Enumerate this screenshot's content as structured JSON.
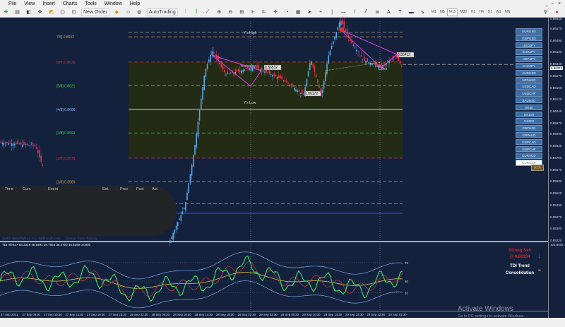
{
  "menu": [
    "File",
    "View",
    "Insert",
    "Charts",
    "Tools",
    "Window",
    "Help"
  ],
  "toolbar": {
    "new_order": "New Order",
    "autotrading": "AutoTrading",
    "timeframes": [
      "M1",
      "M5",
      "M15",
      "M30",
      "H1",
      "H4",
      "D1",
      "W1",
      "MN"
    ],
    "active_timeframe": "M15"
  },
  "price_axis": [
    "0.86570",
    "0.86495",
    "0.86420",
    "0.86345",
    "0.86270",
    "0.86195",
    "0.86120",
    "0.86045",
    "0.85970",
    "0.85900",
    "0.85825",
    "0.85750",
    "0.85675",
    "0.85600",
    "0.85525",
    "0.85450",
    "0.85375",
    "0.85300",
    "0.85225"
  ],
  "current_price": "0.86318",
  "top_price": "0.86645",
  "symbols": [
    "EURUSD",
    "GBPUSD",
    "USDJPY",
    "EURJPY",
    "GBPJPY",
    "CADJPY",
    "AUDUSD",
    "NZDUSD",
    "USDCAD",
    "USDCHF",
    "XAUUSD",
    "HK50",
    "UK100",
    "US500",
    "GBPNZD",
    "GBPAUD",
    "GBPCAD",
    "GBPCHF",
    "EURAUD",
    "EURGBP"
  ],
  "active_symbol": "EURGBP",
  "atr_label": "ATR",
  "murrey": [
    {
      "label": "7/8] 0.8652",
      "color": "#e0a040",
      "price": 0.8652
    },
    {
      "label": "[6/8] 0.8636",
      "color": "#e03040",
      "price": 0.8636
    },
    {
      "label": "[5/8] 0.8621",
      "color": "#40d040",
      "price": 0.8621
    },
    {
      "label": "[4/8] 0.8606",
      "color": "#8fb8ff",
      "price": 0.8606
    },
    {
      "label": "[3/8] 0.8591",
      "color": "#40d040",
      "price": 0.8591
    },
    {
      "label": "[2/8] 0.8575",
      "color": "#e03040",
      "price": 0.8575
    },
    {
      "label": "[1/8] 0.8560",
      "color": "#e0a040",
      "price": 0.856
    }
  ],
  "annotations": {
    "ys_high": "Y's High",
    "ys_low": "Y's Low",
    "yesterday": "Yesterday",
    "today": "Today",
    "open": "Open",
    "lbl1": "0.86532",
    "lbl2": "0.86172",
    "lbl3": "0.86412"
  },
  "news": {
    "headers": [
      "Time",
      "Curr.",
      "Event",
      "Est.",
      "Prev",
      "Fcst",
      "Act"
    ],
    "footer": "SiaFX News2Wb v2.7.1 - darkmooth.com",
    "source": "Source: Forex Factory"
  },
  "tdi": {
    "label": "TDI Alerts • 54.3319 46.5491 38.7664 38.4700 46.5159 0.0000",
    "levels": [
      "78",
      "50",
      "32"
    ],
    "axis_top": "101.8892",
    "signal": "Strong Sell",
    "signal_price": "@ 0.86334",
    "trend": "TDI Trend",
    "trend_state": "Consolidation",
    "signal_color": "#e02020"
  },
  "time_axis": [
    "27 Sep 2021",
    "27 Sep 06:30",
    "27 Sep 10:30",
    "27 Sep 14:30",
    "27 Sep 18:30",
    "27 Sep 22:30",
    "28 Sep 02:30",
    "28 Sep 06:30",
    "28 Sep 10:30",
    "28 Sep 14:30",
    "28 Sep 18:30",
    "28 Sep 22:30",
    "29 Sep 02:30",
    "29 Sep 06:30",
    "29 Sep 10:30",
    "29 Sep 14:30",
    "29 Sep 18:30",
    "29 Sep 22:30",
    "30 Sep 02:30"
  ],
  "watermark": {
    "title": "Activate Windows",
    "sub": "Go to PC settings to activate Windows."
  }
}
